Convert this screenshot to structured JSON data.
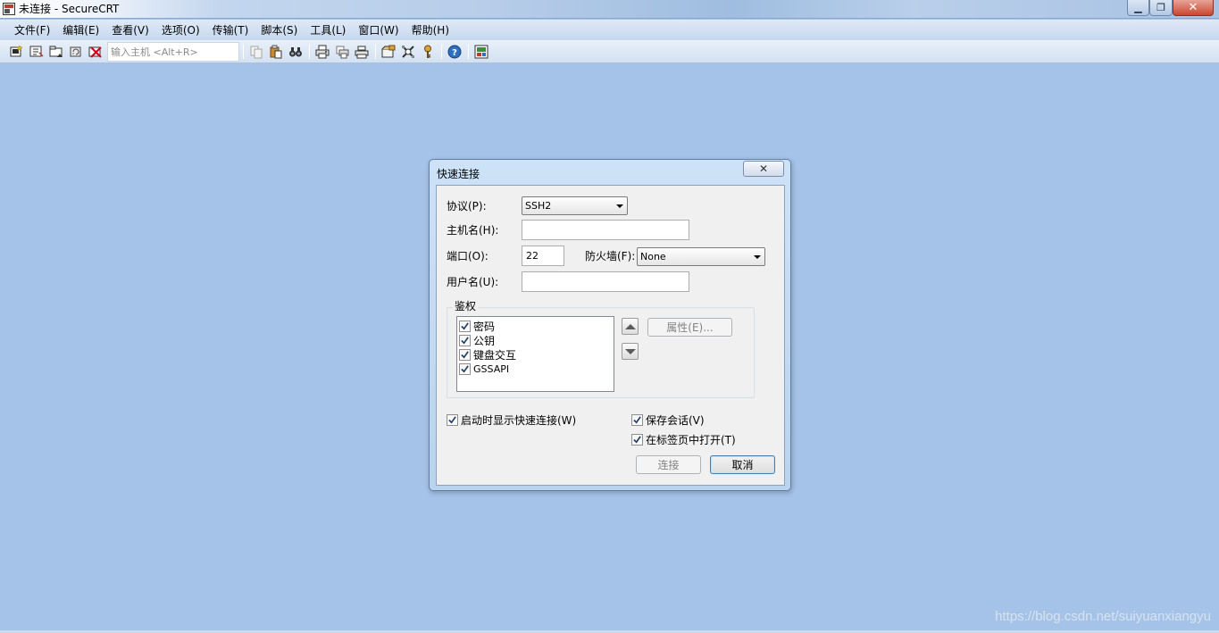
{
  "window": {
    "title": "未连接 - SecureCRT"
  },
  "menu": [
    "文件(F)",
    "编辑(E)",
    "查看(V)",
    "选项(O)",
    "传输(T)",
    "脚本(S)",
    "工具(L)",
    "窗口(W)",
    "帮助(H)"
  ],
  "toolbar": {
    "host_placeholder": "输入主机 <Alt+R>",
    "icons": [
      "connect-icon",
      "quick-connect-icon",
      "connect-in-tab-icon",
      "reconnect-icon",
      "disconnect-icon",
      "copy-icon",
      "paste-icon",
      "find-icon",
      "print-screen-icon",
      "print-selection-icon",
      "print-icon",
      "session-options-icon",
      "global-options-icon",
      "keymap-icon",
      "help-icon",
      "sftp-icon"
    ]
  },
  "dialog": {
    "title": "快速连接",
    "protocol_label": "协议(P):",
    "protocol_value": "SSH2",
    "hostname_label": "主机名(H):",
    "hostname_value": "",
    "port_label": "端口(O):",
    "port_value": "22",
    "firewall_label": "防火墙(F):",
    "firewall_value": "None",
    "username_label": "用户名(U):",
    "username_value": "",
    "auth_group_label": "鉴权",
    "auth_methods": [
      {
        "label": "密码",
        "checked": true
      },
      {
        "label": "公钥",
        "checked": true
      },
      {
        "label": "键盘交互",
        "checked": true
      },
      {
        "label": "GSSAPI",
        "checked": true
      }
    ],
    "properties_button": "属性(E)...",
    "show_on_startup_label": "启动时显示快速连接(W)",
    "save_session_label": "保存会话(V)",
    "open_in_tab_label": "在标签页中打开(T)",
    "connect_button": "连接",
    "cancel_button": "取消"
  },
  "watermark": "https://blog.csdn.net/suiyuanxiangyu"
}
